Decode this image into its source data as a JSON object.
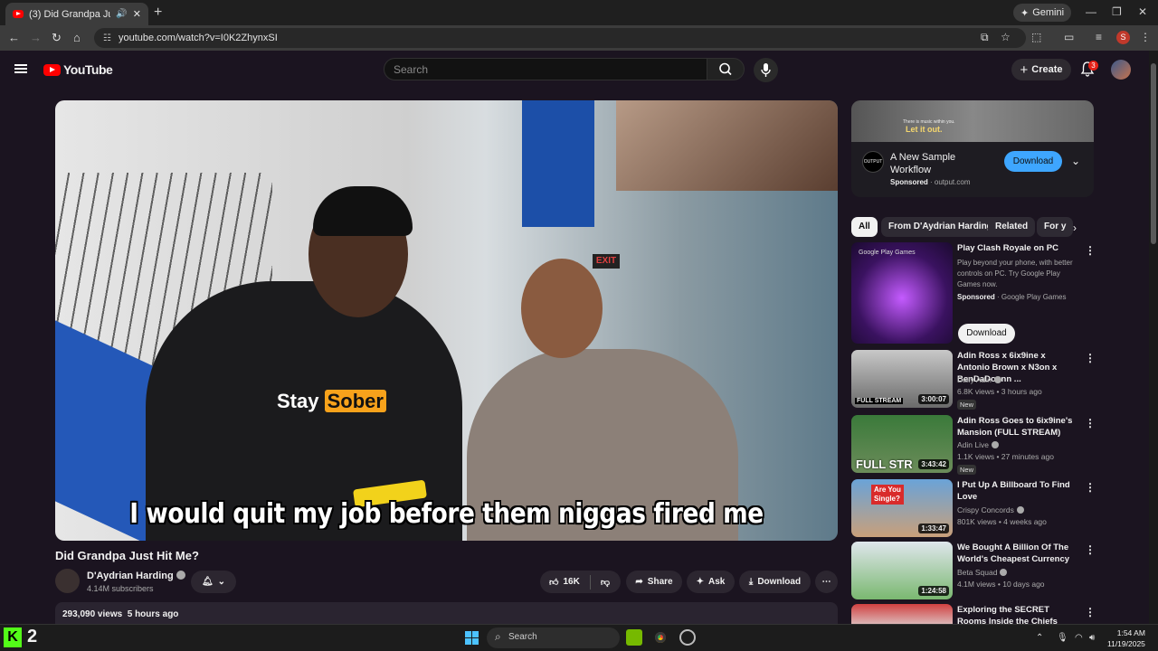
{
  "browser": {
    "tab_title": "(3) Did Grandpa Just Hit Me?",
    "new_tab": "+",
    "gemini_label": "Gemini",
    "url": "youtube.com/watch?v=I0K2ZhynxSI",
    "profile_initial": "S"
  },
  "header": {
    "logo_text": "YouTube",
    "search_placeholder": "Search",
    "create_label": "Create",
    "notification_count": "3"
  },
  "video": {
    "caption": "I would quit my job before them niggas fired me",
    "shirt_text_1": "Stay",
    "shirt_text_2": "Sober",
    "exit_sign": "EXIT",
    "title": "Did Grandpa Just Hit Me?",
    "channel_name": "D'Aydrian Harding",
    "subscribers": "4.14M subscribers",
    "likes": "16K",
    "share_label": "Share",
    "ask_label": "Ask",
    "download_label": "Download",
    "views": "293,090 views",
    "age": "5 hours ago"
  },
  "ad": {
    "image_small_text": "There is music within you.",
    "image_text": "Let it out.",
    "logo_text": "OUTPUT",
    "title": "A New Sample Workflow",
    "sponsored": "Sponsored",
    "domain": "· output.com",
    "button": "Download"
  },
  "chips": [
    "All",
    "From D'Aydrian Harding",
    "Related",
    "For y"
  ],
  "recommendations": [
    {
      "title": "Play Clash Royale on PC",
      "desc": "Play beyond your phone, with better controls on PC. Try Google Play Games now.",
      "sponsored": "Sponsored",
      "source": "· Google Play Games",
      "button": "Download",
      "thumb_label": "Google Play Games"
    },
    {
      "title": "Adin Ross x 6ix9ine x Antonio Brown x N3on x BenDaDonnn ...",
      "channel": "Daily Adin",
      "meta": "6.8K views • 3 hours ago",
      "badge": "New",
      "duration": "3:00:07",
      "thumb_label": "FULL STREAM"
    },
    {
      "title": "Adin Ross Goes to 6ix9ine's Mansion (FULL STREAM)",
      "channel": "Adin Live",
      "meta": "1.1K views • 27 minutes ago",
      "badge": "New",
      "duration": "3:43:42",
      "thumb_label": "FULL STR"
    },
    {
      "title": "I Put Up A Billboard To Find Love",
      "channel": "Crispy Concords",
      "meta": "801K views • 4 weeks ago",
      "duration": "1:33:47",
      "thumb_label": "Are You Single?"
    },
    {
      "title": "We Bought A Billion Of The World's Cheapest Currency",
      "channel": "Beta Squad",
      "meta": "4.1M views • 10 days ago",
      "duration": "1:24:58"
    },
    {
      "title": "Exploring the SECRET Rooms Inside the Chiefs Stadium"
    }
  ],
  "taskbar": {
    "kick_letter": "K",
    "kick_number": "2",
    "search_label": "Search",
    "time": "1:54 AM",
    "date": "11/19/2025"
  },
  "colors": {
    "youtube_red": "#ff0000",
    "download_blue": "#3ea6ff",
    "background": "#1b1420"
  }
}
